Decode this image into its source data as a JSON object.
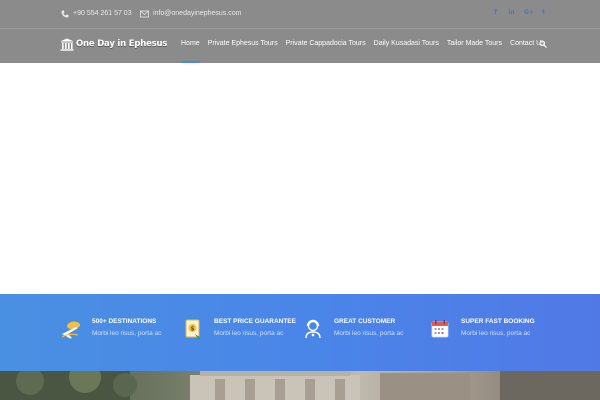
{
  "topbar": {
    "phone": "+90 554 261 57 03",
    "email": "info@onedayinephesus.com",
    "social": [
      {
        "name": "facebook-icon",
        "glyph": "f"
      },
      {
        "name": "linkedin-icon",
        "glyph": "in"
      },
      {
        "name": "google-plus-icon",
        "glyph": "G+"
      },
      {
        "name": "twitter-icon",
        "glyph": "t"
      }
    ]
  },
  "header": {
    "logo_text": "One Day in Ephesus",
    "nav": [
      {
        "label": "Home",
        "active": true
      },
      {
        "label": "Private Ephesus Tours"
      },
      {
        "label": "Private Cappadocia Tours"
      },
      {
        "label": "Daily Kusadasi Tours"
      },
      {
        "label": "Tailor Made Tours"
      },
      {
        "label": "Contact Us"
      }
    ]
  },
  "features": [
    {
      "title": "500+ DESTINATIONS",
      "subtitle": "Morbi leo risus, porta ac",
      "icon": "plane-cloud-icon"
    },
    {
      "title": "BEST PRICE GUARANTEE",
      "subtitle": "Morbi leo risus, porta ac",
      "icon": "price-tag-icon"
    },
    {
      "title": "GREAT CUSTOMER",
      "subtitle": "Morbi leo risus, porta ac",
      "icon": "customer-support-icon"
    },
    {
      "title": "SUPER FAST BOOKING",
      "subtitle": "Morbi leo risus, porta ac",
      "icon": "calendar-icon"
    }
  ],
  "colors": {
    "header_bg": "#8b8b8b",
    "accent": "#3d8de9",
    "band_start": "#4a90e2",
    "band_end": "#5179e6"
  }
}
